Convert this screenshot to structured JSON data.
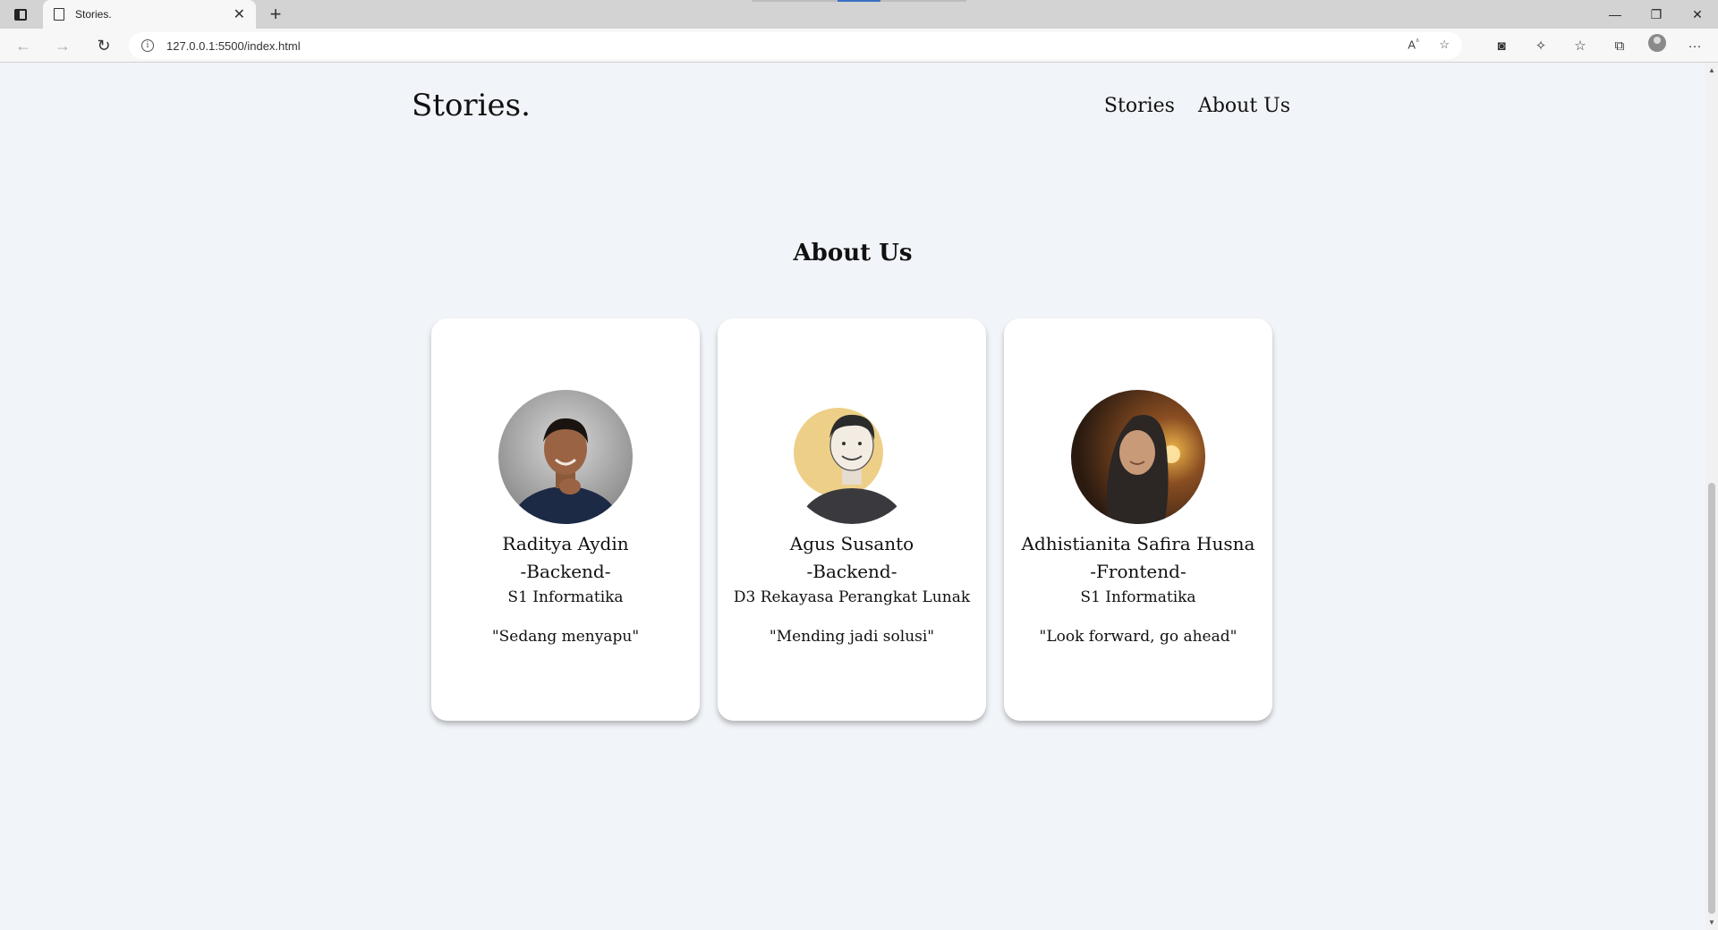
{
  "browser": {
    "tab_title": "Stories.",
    "url": "127.0.0.1:5500/index.html"
  },
  "site": {
    "brand": "Stories.",
    "nav": [
      {
        "label": "Stories"
      },
      {
        "label": "About Us"
      }
    ]
  },
  "about": {
    "title": "About Us",
    "members": [
      {
        "name": "Raditya Aydin",
        "role": "-Backend-",
        "education": "S1 Informatika",
        "quote": "\"Sedang menyapu\""
      },
      {
        "name": "Agus Susanto",
        "role": "-Backend-",
        "education": "D3 Rekayasa Perangkat Lunak",
        "quote": "\"Mending jadi solusi\""
      },
      {
        "name": "Adhistianita Safira Husna",
        "role": "-Frontend-",
        "education": "S1 Informatika",
        "quote": "\"Look forward, go ahead\""
      }
    ]
  }
}
